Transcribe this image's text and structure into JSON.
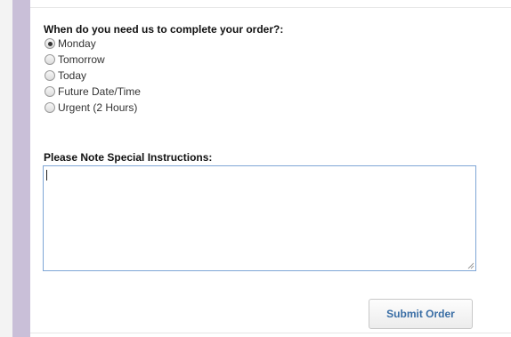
{
  "form": {
    "question": "When do you need us to complete your order?:",
    "options": [
      {
        "label": "Monday",
        "checked": true
      },
      {
        "label": "Tomorrow",
        "checked": false
      },
      {
        "label": "Today",
        "checked": false
      },
      {
        "label": "Future Date/Time",
        "checked": false
      },
      {
        "label": "Urgent (2 Hours)",
        "checked": false
      }
    ],
    "instructions_label": "Please Note Special Instructions:",
    "instructions_value": "",
    "submit_label": "Submit Order"
  },
  "colors": {
    "accent_bar": "#c9bfd8",
    "textarea_border": "#7fa6d6",
    "submit_text": "#3a6ea5"
  }
}
